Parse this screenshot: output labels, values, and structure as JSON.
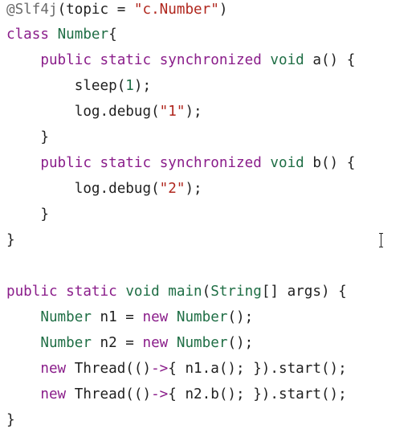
{
  "code": {
    "lines": [
      [
        {
          "t": "@Slf4j",
          "c": "ann"
        },
        {
          "t": "(topic = "
        },
        {
          "t": "\"c.Number\"",
          "c": "str"
        },
        {
          "t": ")"
        }
      ],
      [
        {
          "t": "class",
          "c": "kw"
        },
        {
          "t": " "
        },
        {
          "t": "Number",
          "c": "type"
        },
        {
          "t": "{"
        }
      ],
      [
        {
          "t": "    "
        },
        {
          "t": "public",
          "c": "kw"
        },
        {
          "t": " "
        },
        {
          "t": "static",
          "c": "kw"
        },
        {
          "t": " "
        },
        {
          "t": "synchronized",
          "c": "kw"
        },
        {
          "t": " "
        },
        {
          "t": "void",
          "c": "type"
        },
        {
          "t": " a() {"
        }
      ],
      [
        {
          "t": "        sleep("
        },
        {
          "t": "1",
          "c": "num"
        },
        {
          "t": ");"
        }
      ],
      [
        {
          "t": "        log.debug("
        },
        {
          "t": "\"1\"",
          "c": "str"
        },
        {
          "t": ");"
        }
      ],
      [
        {
          "t": "    }"
        }
      ],
      [
        {
          "t": "    "
        },
        {
          "t": "public",
          "c": "kw"
        },
        {
          "t": " "
        },
        {
          "t": "static",
          "c": "kw"
        },
        {
          "t": " "
        },
        {
          "t": "synchronized",
          "c": "kw"
        },
        {
          "t": " "
        },
        {
          "t": "void",
          "c": "type"
        },
        {
          "t": " b() {"
        }
      ],
      [
        {
          "t": "        log.debug("
        },
        {
          "t": "\"2\"",
          "c": "str"
        },
        {
          "t": ");"
        }
      ],
      [
        {
          "t": "    }"
        }
      ],
      [
        {
          "t": "}"
        }
      ],
      [],
      [
        {
          "t": "public",
          "c": "kw"
        },
        {
          "t": " "
        },
        {
          "t": "static",
          "c": "kw"
        },
        {
          "t": " "
        },
        {
          "t": "void",
          "c": "type"
        },
        {
          "t": " "
        },
        {
          "t": "main",
          "c": "type"
        },
        {
          "t": "("
        },
        {
          "t": "String",
          "c": "type"
        },
        {
          "t": "[] args) {"
        }
      ],
      [
        {
          "t": "    "
        },
        {
          "t": "Number",
          "c": "type"
        },
        {
          "t": " n1 = "
        },
        {
          "t": "new",
          "c": "kw"
        },
        {
          "t": " "
        },
        {
          "t": "Number",
          "c": "type"
        },
        {
          "t": "();"
        }
      ],
      [
        {
          "t": "    "
        },
        {
          "t": "Number",
          "c": "type"
        },
        {
          "t": " n2 = "
        },
        {
          "t": "new",
          "c": "kw"
        },
        {
          "t": " "
        },
        {
          "t": "Number",
          "c": "type"
        },
        {
          "t": "();"
        }
      ],
      [
        {
          "t": "    "
        },
        {
          "t": "new",
          "c": "kw"
        },
        {
          "t": " Thread(()"
        },
        {
          "t": "->",
          "c": "kw"
        },
        {
          "t": "{ n1.a(); }).start();"
        }
      ],
      [
        {
          "t": "    "
        },
        {
          "t": "new",
          "c": "kw"
        },
        {
          "t": " Thread(()"
        },
        {
          "t": "->",
          "c": "kw"
        },
        {
          "t": "{ n2.b(); }).start();"
        }
      ],
      [
        {
          "t": "}"
        }
      ]
    ]
  },
  "icons": {
    "cursor": "text-cursor-icon"
  }
}
